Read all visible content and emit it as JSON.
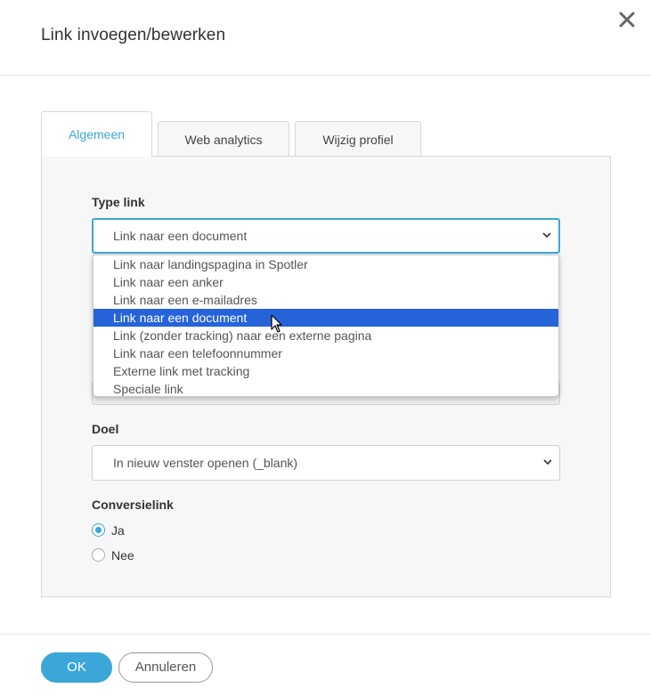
{
  "dialog": {
    "title": "Link invoegen/bewerken",
    "close_icon": "close-icon"
  },
  "tabs": [
    {
      "label": "Algemeen",
      "active": true
    },
    {
      "label": "Web analytics",
      "active": false
    },
    {
      "label": "Wijzig profiel",
      "active": false
    }
  ],
  "form": {
    "link_type": {
      "label": "Type link",
      "value": "Link naar een document",
      "options": [
        "Link naar landingspagina in Spotler",
        "Link naar een anker",
        "Link naar een e-mailadres",
        "Link naar een document",
        "Link (zonder tracking) naar een externe pagina",
        "Link naar een telefoonnummer",
        "Externe link met tracking",
        "Speciale link"
      ],
      "selected_index": 3
    },
    "target": {
      "label": "Doel",
      "value": "In nieuw venster openen (_blank)"
    },
    "conversion": {
      "label": "Conversielink",
      "options": [
        {
          "label": "Ja",
          "checked": true
        },
        {
          "label": "Nee",
          "checked": false
        }
      ]
    }
  },
  "footer": {
    "ok_label": "OK",
    "cancel_label": "Annuleren"
  },
  "colors": {
    "accent": "#3aa7d8",
    "selection": "#2563d9"
  }
}
